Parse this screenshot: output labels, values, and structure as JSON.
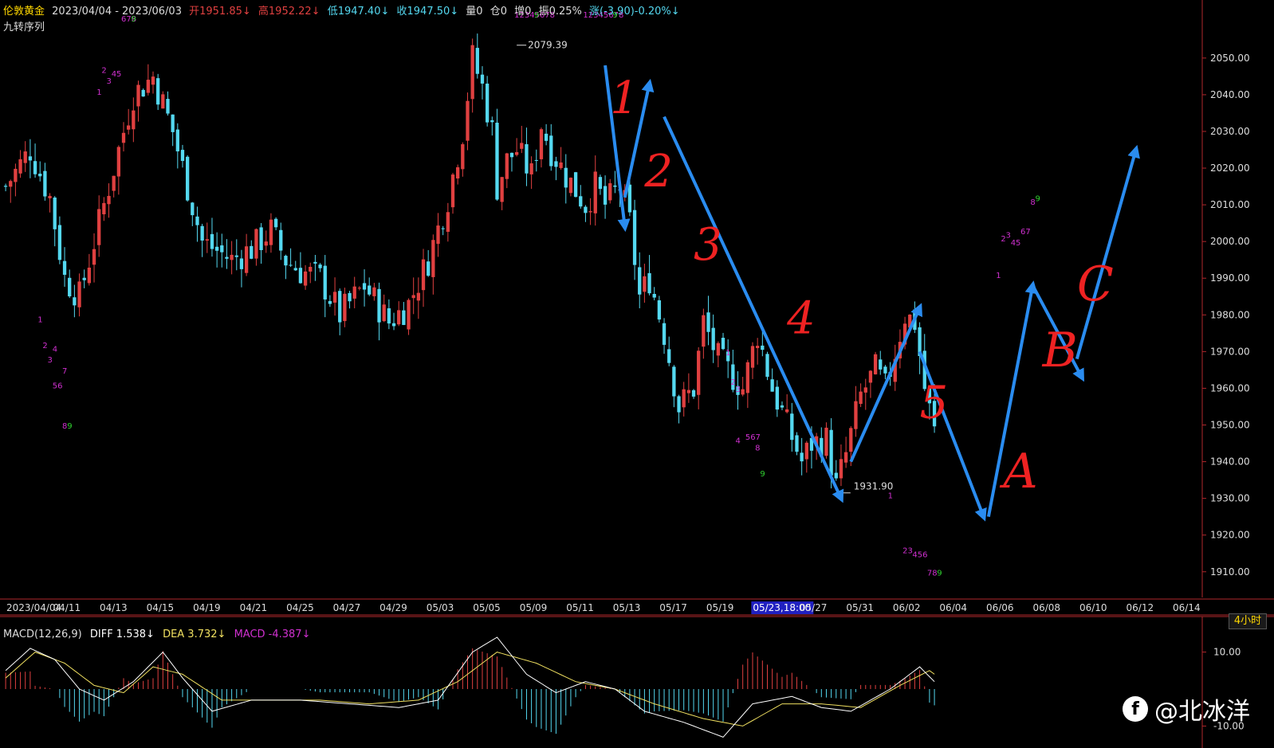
{
  "header": {
    "symbol": "伦敦黄金",
    "date_range": "2023/04/04 - 2023/06/03",
    "open": "开1951.85↓",
    "high": "高1952.22↓",
    "low": "低1947.40↓",
    "close": "收1947.50↓",
    "volume": "量0",
    "position": "仓0",
    "increase": "增0",
    "amplitude": "振0.25%",
    "change": "涨(-3.90)-0.20%↓"
  },
  "indicator_label": "九转序列",
  "period_label": "4小时",
  "watermark": "@北冰洋",
  "macd_header": {
    "name": "MACD(12,26,9)",
    "diff": "DIFF 1.538↓",
    "dea": "DEA 3.732↓",
    "macd": "MACD -4.387↓"
  },
  "colors": {
    "up": "#e04040",
    "down": "#54d8f0",
    "axis": "#b0272c",
    "arrow": "#2a8cf0",
    "annotation": "#ee2222",
    "td": "#d030d0",
    "td9": "#30d030",
    "dea": "#f0e060",
    "diff": "#ffffff"
  },
  "chart_data": {
    "type": "candlestick",
    "title": "伦敦黄金 4小时",
    "ylim": [
      1903,
      2058
    ],
    "y_ticks": [
      1910,
      1920,
      1930,
      1940,
      1950,
      1960,
      1970,
      1980,
      1990,
      2000,
      2010,
      2020,
      2030,
      2040,
      2050
    ],
    "x_ticks": [
      "2023/04/04",
      "04/11",
      "04/13",
      "04/15",
      "04/19",
      "04/21",
      "04/25",
      "04/27",
      "04/29",
      "05/03",
      "05/05",
      "05/09",
      "05/11",
      "05/13",
      "05/17",
      "05/19",
      "05/23,18:00",
      "05/27",
      "05/31",
      "06/02",
      "06/04",
      "06/06",
      "06/08",
      "06/10",
      "06/12",
      "06/14"
    ],
    "highlighted_tick": "05/23,18:00",
    "close_path": [
      [
        0,
        2015
      ],
      [
        5,
        2025
      ],
      [
        9,
        2012
      ],
      [
        12,
        1990
      ],
      [
        15,
        1985
      ],
      [
        20,
        2010
      ],
      [
        26,
        2040
      ],
      [
        30,
        2045
      ],
      [
        34,
        2030
      ],
      [
        37,
        2015
      ],
      [
        40,
        2000
      ],
      [
        46,
        1995
      ],
      [
        50,
        1998
      ],
      [
        54,
        2003
      ],
      [
        57,
        1995
      ],
      [
        60,
        1992
      ],
      [
        64,
        1990
      ],
      [
        68,
        1980
      ],
      [
        73,
        1988
      ],
      [
        78,
        1978
      ],
      [
        82,
        1983
      ],
      [
        86,
        1995
      ],
      [
        90,
        2012
      ],
      [
        93,
        2030
      ],
      [
        95,
        2050
      ],
      [
        97,
        2042
      ],
      [
        99,
        2030
      ],
      [
        100,
        2015
      ],
      [
        102,
        2022
      ],
      [
        104,
        2025
      ],
      [
        107,
        2018
      ],
      [
        109,
        2032
      ],
      [
        111,
        2025
      ],
      [
        114,
        2018
      ],
      [
        118,
        2010
      ],
      [
        120,
        2015
      ],
      [
        122,
        2010
      ],
      [
        125,
        2015
      ],
      [
        127,
        2005
      ],
      [
        129,
        1985
      ],
      [
        131,
        1990
      ],
      [
        134,
        1975
      ],
      [
        137,
        1955
      ],
      [
        140,
        1960
      ],
      [
        142,
        1978
      ],
      [
        145,
        1968
      ],
      [
        150,
        1960
      ],
      [
        153,
        1975
      ],
      [
        156,
        1960
      ],
      [
        159,
        1950
      ],
      [
        162,
        1940
      ],
      [
        164,
        1945
      ],
      [
        167,
        1946
      ],
      [
        169,
        1933
      ],
      [
        171,
        1942
      ],
      [
        174,
        1958
      ],
      [
        177,
        1965
      ],
      [
        179,
        1960
      ],
      [
        181,
        1970
      ],
      [
        183,
        1980
      ],
      [
        185,
        1978
      ],
      [
        187,
        1960
      ],
      [
        189,
        1948
      ]
    ],
    "annotations": {
      "high_label": "2079.39",
      "low_label": "1931.90",
      "wave_labels": [
        "1",
        "2",
        "3",
        "4",
        "5",
        "A",
        "B",
        "C"
      ]
    },
    "td_sequence": [
      {
        "text": "1",
        "bar": 7,
        "value": 1978,
        "color": "td"
      },
      {
        "text": "2",
        "bar": 8,
        "value": 1971,
        "color": "td"
      },
      {
        "text": "4",
        "bar": 10,
        "value": 1970,
        "color": "td"
      },
      {
        "text": "3",
        "bar": 9,
        "value": 1967,
        "color": "td"
      },
      {
        "text": "7",
        "bar": 12,
        "value": 1964,
        "color": "td"
      },
      {
        "text": "56",
        "bar": 10,
        "value": 1960,
        "color": "td"
      },
      {
        "text": "8",
        "bar": 12,
        "value": 1949,
        "color": "td"
      },
      {
        "text": "9",
        "bar": 13,
        "value": 1949,
        "color": "td9"
      },
      {
        "text": "1",
        "bar": 19,
        "value": 2040,
        "color": "td"
      },
      {
        "text": "2",
        "bar": 20,
        "value": 2046,
        "color": "td"
      },
      {
        "text": "3",
        "bar": 21,
        "value": 2043,
        "color": "td"
      },
      {
        "text": "45",
        "bar": 22,
        "value": 2045,
        "color": "td"
      },
      {
        "text": "678",
        "bar": 24,
        "value": 2060,
        "color": "td"
      },
      {
        "text": "9",
        "bar": 26,
        "value": 2060,
        "color": "td9"
      },
      {
        "text": "12345678",
        "bar": 104,
        "value": 2061,
        "color": "td"
      },
      {
        "text": "9",
        "bar": 108,
        "value": 2061,
        "color": "td9"
      },
      {
        "text": "12345678",
        "bar": 118,
        "value": 2061,
        "color": "td"
      },
      {
        "text": "9",
        "bar": 124,
        "value": 2061,
        "color": "td9"
      },
      {
        "text": "1",
        "bar": 147,
        "value": 1969,
        "color": "td"
      },
      {
        "text": "2",
        "bar": 148,
        "value": 1961,
        "color": "td"
      },
      {
        "text": "3",
        "bar": 149,
        "value": 1959,
        "color": "td"
      },
      {
        "text": "4",
        "bar": 149,
        "value": 1945,
        "color": "td"
      },
      {
        "text": "567",
        "bar": 151,
        "value": 1946,
        "color": "td"
      },
      {
        "text": "8",
        "bar": 153,
        "value": 1943,
        "color": "td"
      },
      {
        "text": "9",
        "bar": 154,
        "value": 1936,
        "color": "td9"
      },
      {
        "text": "1",
        "bar": 180,
        "value": 1930,
        "color": "td"
      },
      {
        "text": "23",
        "bar": 183,
        "value": 1915,
        "color": "td"
      },
      {
        "text": "456",
        "bar": 185,
        "value": 1914,
        "color": "td"
      },
      {
        "text": "78",
        "bar": 188,
        "value": 1909,
        "color": "td"
      },
      {
        "text": "9",
        "bar": 190,
        "value": 1909,
        "color": "td9"
      },
      {
        "text": "1",
        "bar": 202,
        "value": 1990,
        "color": "td"
      },
      {
        "text": "2",
        "bar": 203,
        "value": 2000,
        "color": "td"
      },
      {
        "text": "3",
        "bar": 204,
        "value": 2001,
        "color": "td"
      },
      {
        "text": "45",
        "bar": 205,
        "value": 1999,
        "color": "td"
      },
      {
        "text": "67",
        "bar": 207,
        "value": 2002,
        "color": "td"
      },
      {
        "text": "8",
        "bar": 209,
        "value": 2010,
        "color": "td"
      },
      {
        "text": "9",
        "bar": 210,
        "value": 2011,
        "color": "td9"
      }
    ],
    "macd": {
      "ylim": [
        -14,
        14
      ],
      "y_ticks": [
        -10,
        10
      ],
      "diff_path": [
        [
          0,
          5
        ],
        [
          5,
          11
        ],
        [
          10,
          8
        ],
        [
          15,
          0
        ],
        [
          20,
          -3
        ],
        [
          26,
          2
        ],
        [
          32,
          10
        ],
        [
          36,
          3
        ],
        [
          42,
          -6
        ],
        [
          50,
          -3
        ],
        [
          60,
          -3
        ],
        [
          70,
          -4
        ],
        [
          80,
          -5
        ],
        [
          88,
          -3
        ],
        [
          95,
          10
        ],
        [
          100,
          14
        ],
        [
          106,
          4
        ],
        [
          112,
          -1
        ],
        [
          118,
          2
        ],
        [
          124,
          0
        ],
        [
          130,
          -6
        ],
        [
          138,
          -9
        ],
        [
          146,
          -13
        ],
        [
          152,
          -4
        ],
        [
          160,
          -2
        ],
        [
          166,
          -5
        ],
        [
          172,
          -6
        ],
        [
          180,
          0
        ],
        [
          186,
          6
        ],
        [
          189,
          2
        ]
      ],
      "dea_path": [
        [
          0,
          3
        ],
        [
          6,
          10
        ],
        [
          12,
          7
        ],
        [
          18,
          1
        ],
        [
          24,
          -1
        ],
        [
          30,
          6
        ],
        [
          36,
          4
        ],
        [
          44,
          -3
        ],
        [
          54,
          -3
        ],
        [
          64,
          -3
        ],
        [
          74,
          -4
        ],
        [
          84,
          -3
        ],
        [
          92,
          2
        ],
        [
          100,
          10
        ],
        [
          108,
          7
        ],
        [
          116,
          2
        ],
        [
          124,
          0
        ],
        [
          132,
          -4
        ],
        [
          142,
          -8
        ],
        [
          150,
          -10
        ],
        [
          158,
          -4
        ],
        [
          166,
          -4
        ],
        [
          174,
          -5
        ],
        [
          182,
          1
        ],
        [
          188,
          5
        ],
        [
          189,
          4
        ]
      ]
    },
    "wave_lines": [
      {
        "from": [
          122,
          2048
        ],
        "to": [
          126,
          2004
        ]
      },
      {
        "from": [
          126,
          2012
        ],
        "to": [
          131,
          2043
        ]
      },
      {
        "from": [
          134,
          2034
        ],
        "to": [
          170,
          1930
        ]
      },
      {
        "from": [
          172,
          1940
        ],
        "to": [
          186,
          1982
        ]
      },
      {
        "from": [
          186,
          1970
        ],
        "to": [
          199,
          1925
        ]
      },
      {
        "from": [
          200,
          1925
        ],
        "to": [
          209,
          1988
        ]
      },
      {
        "from": [
          209,
          1988
        ],
        "to": [
          219,
          1963
        ]
      },
      {
        "from": [
          218,
          1968
        ],
        "to": [
          230,
          2025
        ]
      }
    ]
  }
}
